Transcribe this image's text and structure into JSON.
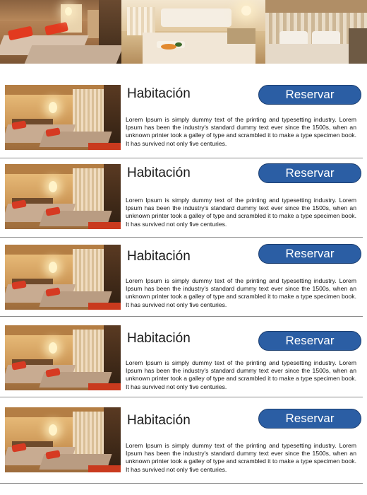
{
  "rooms": [
    {
      "title": "Habitación",
      "button": "Reservar",
      "description": "Lorem Ipsum is simply dummy text of the printing and typesetting industry. Lorem Ipsum has been the industry's standard dummy text ever since the 1500s, when an unknown printer took a galley of type and scrambled it to make a type specimen book. It has survived not only five centuries."
    },
    {
      "title": "Habitación",
      "button": "Reservar",
      "description": "Lorem Ipsum is simply dummy text of the printing and typesetting industry. Lorem Ipsum has been the industry's standard dummy text ever since the 1500s, when an unknown printer took a galley of type and scrambled it to make a type specimen book. It has survived not only five centuries."
    },
    {
      "title": "Habitación",
      "button": "Reservar",
      "description": "Lorem Ipsum is simply dummy text of the printing and typesetting industry. Lorem Ipsum has been the industry's standard dummy text ever since the 1500s, when an unknown printer took a galley of type and scrambled it to make a type specimen book. It has survived not only five centuries."
    },
    {
      "title": "Habitación",
      "button": "Reservar",
      "description": "Lorem Ipsum is simply dummy text of the printing and typesetting industry. Lorem Ipsum has been the industry's standard dummy text ever since the 1500s, when an unknown printer took a galley of type and scrambled it to make a type specimen book. It has survived not only five centuries."
    },
    {
      "title": "Habitación",
      "button": "Reservar",
      "description": "Lorem Ipsum is simply dummy text of the printing and typesetting industry. Lorem Ipsum has been the industry's standard dummy text ever since the 1500s, when an unknown printer took a galley of type and scrambled it to make a type specimen book. It has survived not only five centuries."
    }
  ],
  "colors": {
    "button": "#2b5ea4",
    "button_text": "#ffffff",
    "divider": "#8c8c8c"
  }
}
